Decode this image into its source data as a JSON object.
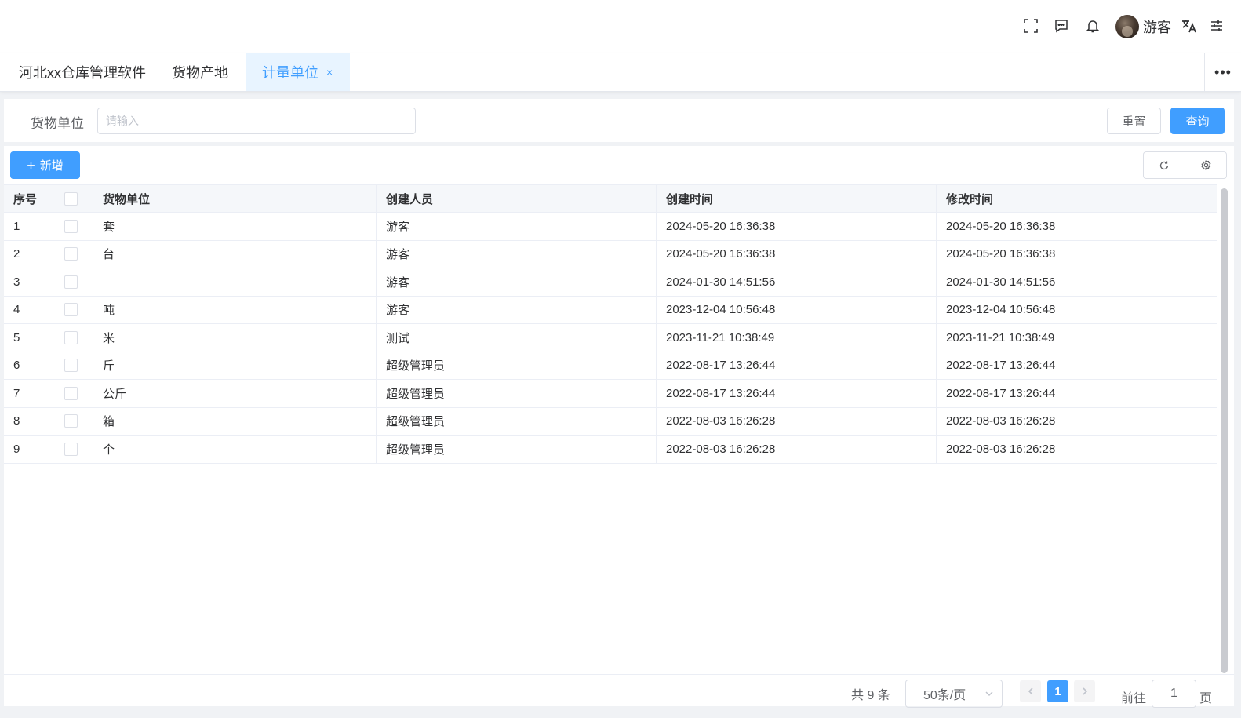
{
  "header": {
    "icons": [
      "fullscreen-icon",
      "message-icon",
      "bell-icon",
      "translate-icon",
      "settings-sliders-icon"
    ],
    "username": "游客"
  },
  "tabs": [
    {
      "label": "河北xx仓库管理软件",
      "active": false
    },
    {
      "label": "货物产地",
      "active": false
    },
    {
      "label": "计量单位",
      "active": true,
      "close": "×"
    }
  ],
  "tabs_more": "•••",
  "search": {
    "label": "货物单位",
    "placeholder": "请输入",
    "value": "",
    "reset_label": "重置",
    "query_label": "查询"
  },
  "toolbar": {
    "add_label": "新增",
    "add_icon": "plus-icon",
    "refresh_icon": "refresh-icon",
    "column_settings_icon": "gear-icon"
  },
  "table": {
    "columns": [
      "序号",
      "",
      "货物单位",
      "创建人员",
      "创建时间",
      "修改时间"
    ],
    "rows": [
      {
        "index": "1",
        "unit": "套",
        "creator": "游客",
        "created": "2024-05-20 16:36:38",
        "modified": "2024-05-20 16:36:38"
      },
      {
        "index": "2",
        "unit": "台",
        "creator": "游客",
        "created": "2024-05-20 16:36:38",
        "modified": "2024-05-20 16:36:38"
      },
      {
        "index": "3",
        "unit": "",
        "creator": "游客",
        "created": "2024-01-30 14:51:56",
        "modified": "2024-01-30 14:51:56"
      },
      {
        "index": "4",
        "unit": "吨",
        "creator": "游客",
        "created": "2023-12-04 10:56:48",
        "modified": "2023-12-04 10:56:48"
      },
      {
        "index": "5",
        "unit": "米",
        "creator": "测试",
        "created": "2023-11-21 10:38:49",
        "modified": "2023-11-21 10:38:49"
      },
      {
        "index": "6",
        "unit": "斤",
        "creator": "超级管理员",
        "created": "2022-08-17 13:26:44",
        "modified": "2022-08-17 13:26:44"
      },
      {
        "index": "7",
        "unit": "公斤",
        "creator": "超级管理员",
        "created": "2022-08-17 13:26:44",
        "modified": "2022-08-17 13:26:44"
      },
      {
        "index": "8",
        "unit": "箱",
        "creator": "超级管理员",
        "created": "2022-08-03 16:26:28",
        "modified": "2022-08-03 16:26:28"
      },
      {
        "index": "9",
        "unit": "个",
        "creator": "超级管理员",
        "created": "2022-08-03 16:26:28",
        "modified": "2022-08-03 16:26:28"
      }
    ]
  },
  "pagination": {
    "total_text": "共 9 条",
    "page_size": "50条/页",
    "current_page": "1",
    "goto_label": "前往",
    "goto_value": "1",
    "page_suffix": "页",
    "prev_icon": "chevron-left-icon",
    "next_icon": "chevron-right-icon"
  },
  "colors": {
    "primary": "#409eff",
    "active_tab_bg": "#e8f4ff",
    "header_bg": "#f5f7fa"
  }
}
